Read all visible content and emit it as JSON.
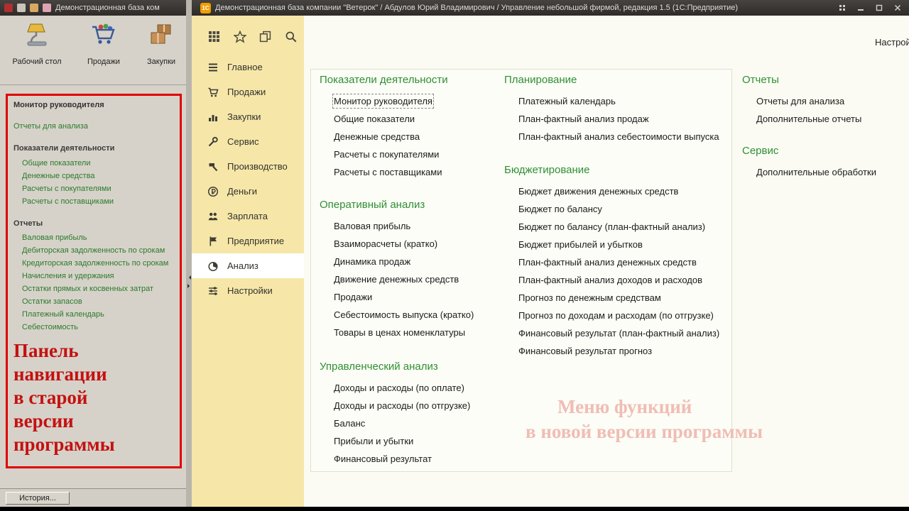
{
  "old_window": {
    "titlebar": {
      "title": "Демонстрационная база ком"
    },
    "toolbar": {
      "items": [
        {
          "label": "Рабочий стол"
        },
        {
          "label": "Продажи"
        },
        {
          "label": "Закупки"
        }
      ]
    },
    "nav": {
      "title": "Монитор руководителя",
      "link": "Отчеты для анализа",
      "section1": {
        "header": "Показатели деятельности",
        "items": [
          "Общие показатели",
          "Денежные средства",
          "Расчеты с покупателями",
          "Расчеты с поставщиками"
        ]
      },
      "section2": {
        "header": "Отчеты",
        "items": [
          "Валовая прибыль",
          "Дебиторская задолженность по срокам",
          "Кредиторская задолженность по срокам",
          "Начисления и удержания",
          "Остатки прямых и косвенных затрат",
          "Остатки запасов",
          "Платежный календарь",
          "Себестоимость"
        ]
      },
      "annotation": "Панель\nнавигации\nв старой\nверсии\nпрограммы"
    },
    "statusbar": {
      "history_button": "История..."
    }
  },
  "new_window": {
    "titlebar": {
      "logo": "1С",
      "title": "Демонстрационная база компании \"Ветерок\" / Абдулов Юрий Владимирович / Управление небольшой фирмой, редакция 1.5 (1С:Предприятие)"
    },
    "settings_link": "Настрой",
    "sidebar": {
      "items": [
        "Главное",
        "Продажи",
        "Закупки",
        "Сервис",
        "Производство",
        "Деньги",
        "Зарплата",
        "Предприятие",
        "Анализ",
        "Настройки"
      ]
    },
    "menu": {
      "col1": {
        "g1": {
          "header": "Показатели деятельности",
          "items": [
            "Монитор руководителя",
            "Общие показатели",
            "Денежные средства",
            "Расчеты с покупателями",
            "Расчеты с поставщиками"
          ]
        },
        "g2": {
          "header": "Оперативный анализ",
          "items": [
            "Валовая прибыль",
            "Взаиморасчеты (кратко)",
            "Динамика продаж",
            "Движение денежных средств",
            "Продажи",
            "Себестоимость выпуска (кратко)",
            "Товары в ценах номенклатуры"
          ]
        },
        "g3": {
          "header": "Управленческий анализ",
          "items": [
            "Доходы и расходы (по оплате)",
            "Доходы и расходы (по отгрузке)",
            "Баланс",
            "Прибыли и убытки",
            "Финансовый результат"
          ]
        }
      },
      "col2": {
        "g1": {
          "header": "Планирование",
          "items": [
            "Платежный календарь",
            "План-фактный анализ продаж",
            "План-фактный анализ себестоимости выпуска"
          ]
        },
        "g2": {
          "header": "Бюджетирование",
          "items": [
            "Бюджет движения денежных средств",
            "Бюджет по балансу",
            "Бюджет по балансу (план-фактный анализ)",
            "Бюджет прибылей и убытков",
            "План-фактный анализ денежных средств",
            "План-фактный анализ доходов и расходов",
            "Прогноз по денежным средствам",
            "Прогноз по доходам и расходам (по отгрузке)",
            "Финансовый результат (план-фактный анализ)",
            "Финансовый результат прогноз"
          ]
        }
      },
      "col3": {
        "g1": {
          "header": "Отчеты",
          "items": [
            "Отчеты для анализа",
            "Дополнительные отчеты"
          ]
        },
        "g2": {
          "header": "Сервис",
          "items": [
            "Дополнительные обработки"
          ]
        }
      },
      "watermark": {
        "line1": "Меню функций",
        "line2": "в новой версии программы"
      }
    }
  },
  "colors": {
    "accent_red": "#e00000",
    "annotation_red": "#c41111",
    "header_green": "#2f8f35",
    "old_link_green": "#2c7a2c",
    "sidebar_yellow": "#f6e7a9",
    "watermark_pink": "#f0bdb4",
    "titlebar_dark": "#35312c"
  }
}
